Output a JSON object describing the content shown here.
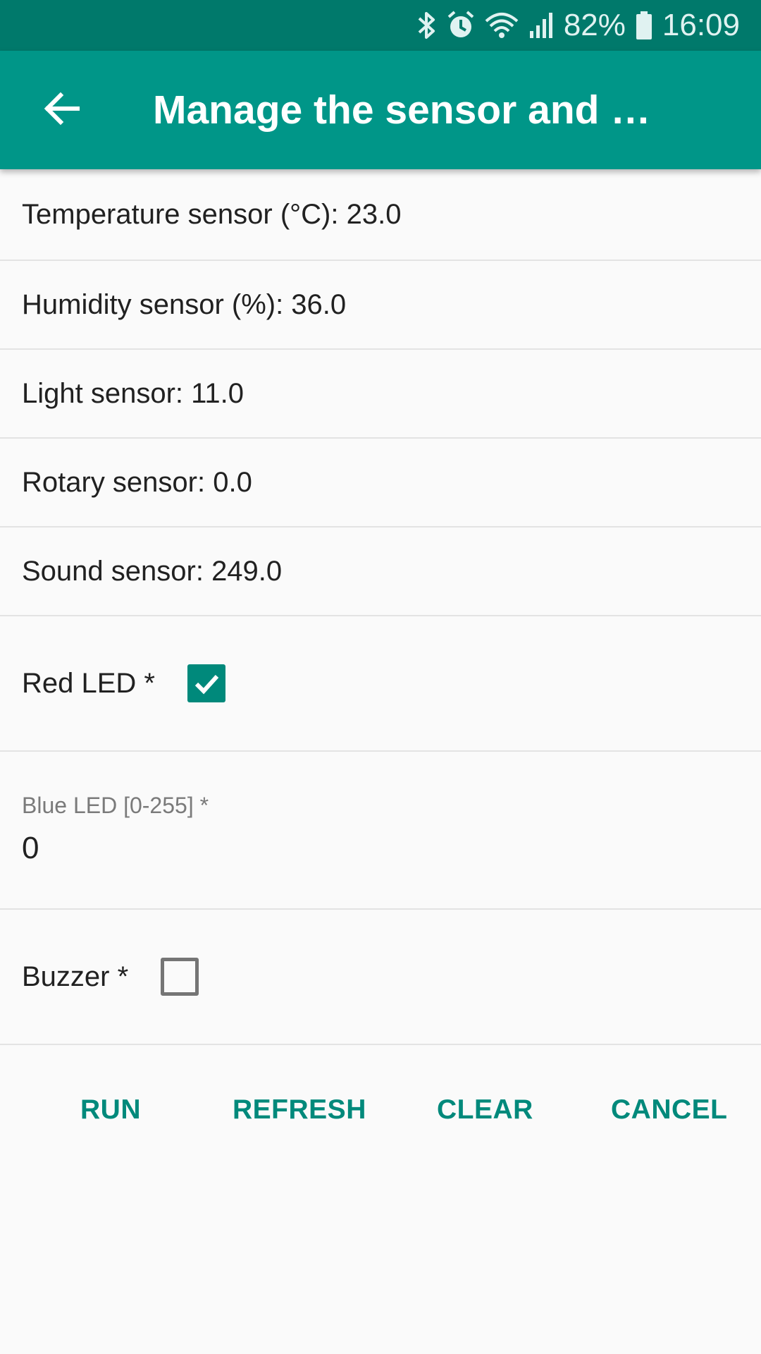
{
  "status_bar": {
    "icons": [
      "bluetooth-icon",
      "alarm-icon",
      "wifi-icon",
      "signal-icon",
      "battery-icon"
    ],
    "battery": "82%",
    "time": "16:09"
  },
  "app_bar": {
    "back_icon": "arrow-left-icon",
    "title": "Manage the sensor and …"
  },
  "sensors": [
    {
      "label": "Temperature sensor (°C): 23.0"
    },
    {
      "label": "Humidity sensor (%): 36.0"
    },
    {
      "label": "Light sensor: 11.0"
    },
    {
      "label": "Rotary sensor: 0.0"
    },
    {
      "label": "Sound sensor: 249.0"
    }
  ],
  "red_led": {
    "label": "Red LED *",
    "checked": true
  },
  "blue_led": {
    "label": "Blue LED [0-255] *",
    "value": "0"
  },
  "buzzer": {
    "label": "Buzzer *",
    "checked": false
  },
  "actions": {
    "run": "RUN",
    "refresh": "REFRESH",
    "clear": "CLEAR",
    "cancel": "CANCEL"
  },
  "colors": {
    "status_bar": "#00796b",
    "app_bar": "#009688",
    "accent": "#00897b"
  }
}
